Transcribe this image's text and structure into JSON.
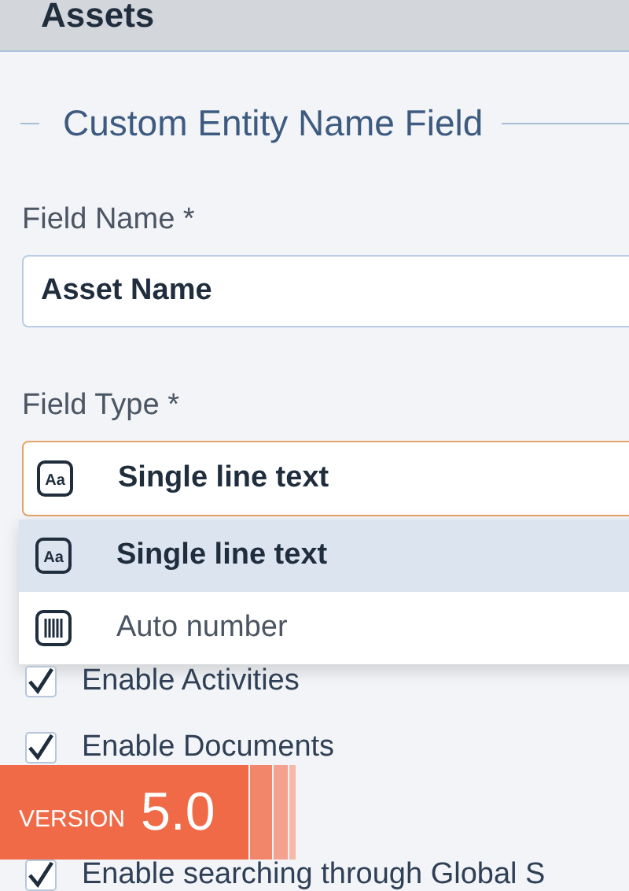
{
  "top_field": {
    "value": "Assets"
  },
  "section": {
    "legend": "Custom Entity Name Field"
  },
  "field_name": {
    "label": "Field Name *",
    "value": "Asset Name"
  },
  "field_type": {
    "label": "Field Type *",
    "value": "Single line text",
    "icon_label": "Aa",
    "kind": "text",
    "options": [
      {
        "label": "Single line text",
        "kind": "text",
        "icon_label": "Aa",
        "selected": true
      },
      {
        "label": "Auto number",
        "kind": "number",
        "selected": false
      }
    ]
  },
  "checkboxes": [
    {
      "label": "Enable Activities",
      "checked": true
    },
    {
      "label": "Enable Documents",
      "checked": true
    },
    {
      "label": "Enable searching through Global S",
      "checked": true
    }
  ],
  "banner": {
    "label": "VERSION",
    "version": "5.0"
  }
}
